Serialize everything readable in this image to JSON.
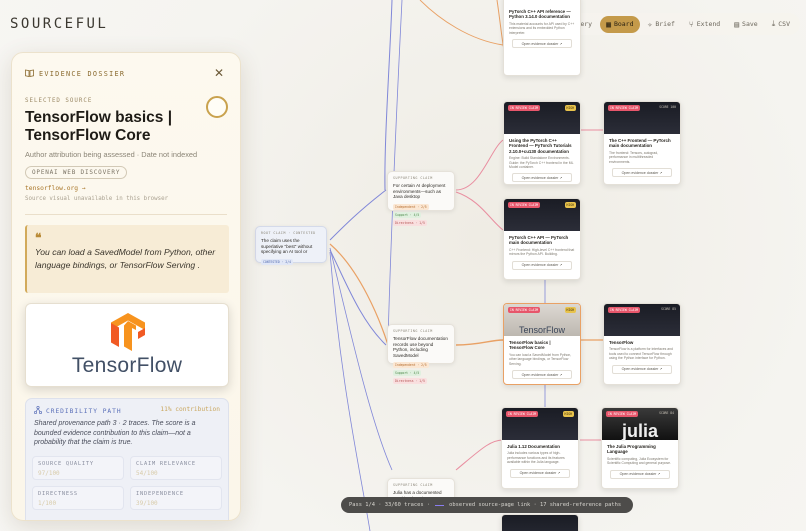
{
  "app": {
    "brand": "SOURCEFUL"
  },
  "toolbar": {
    "items": [
      {
        "label": "Discovery",
        "icon": "compass-icon"
      },
      {
        "label": "Board",
        "icon": "board-icon",
        "active": true
      },
      {
        "label": "Brief",
        "icon": "sparkle-icon"
      },
      {
        "label": "Extend",
        "icon": "branch-icon"
      },
      {
        "label": "Save",
        "icon": "save-icon"
      },
      {
        "label": "CSV",
        "icon": "download-icon"
      }
    ]
  },
  "dossier": {
    "header": "EVIDENCE DOSSIER",
    "selected_label": "SELECTED SOURCE",
    "title": "TensorFlow basics | TensorFlow Core",
    "meta": "Author attribution being assessed · Date not indexed",
    "chip": "OPENAI WEB DISCOVERY",
    "link": "tensorflow.org →",
    "note": "Source visual unavailable in this browser",
    "quote": "You can load a SavedModel from Python, other language bindings, or TensorFlow Serving .",
    "image_word": "TensorFlow",
    "credibility": {
      "heading": "CREDIBILITY PATH",
      "contribution": "11% contribution",
      "text": "Shared provenance path 3 · 2 traces. The score is a bounded evidence contribution to this claim—not a probability that the claim is true.",
      "metrics": [
        {
          "label": "SOURCE QUALITY",
          "value": "97/100"
        },
        {
          "label": "CLAIM RELEVANCE",
          "value": "54/100"
        },
        {
          "label": "DIRECTNESS",
          "value": "1/100"
        },
        {
          "label": "INDEPENDENCE",
          "value": "39/100"
        }
      ]
    }
  },
  "graph": {
    "root": {
      "tag": "ROOT CLAIM · CONTESTED",
      "text": "The claim uses the superlative \"best\" without specifying an AI tool or",
      "pill": "CONTESTED · 2/4"
    },
    "claims": [
      {
        "tag": "SUPPORTING CLAIM",
        "text": "For certain AI deployment environments—such as Java desktop",
        "pills": [
          "Independent · 2/5",
          "Support · 4/5",
          "Directness · 1/5"
        ]
      },
      {
        "tag": "SUPPORTING CLAIM",
        "text": "TensorFlow documentation records use beyond Python, including SavedModel",
        "pills": [
          "Independent · 2/5",
          "Support · 4/5",
          "Directness · 1/5"
        ]
      },
      {
        "tag": "SUPPORTING CLAIM",
        "text": "Julia has a documented machine-learning ecosystem and language-level"
      }
    ],
    "sources": [
      {
        "title": "PyTorch C++ API reference — Python 3.14.0 documentation",
        "desc": "This material accounts for API used by C++ extensions and its embedded Python interpreter.",
        "button": "Open evidence dossier ↗",
        "badge": "",
        "score": ""
      },
      {
        "title": "Using the PyTorch C++ Frontend — PyTorch Tutorials 2.10.0+cu130 documentation",
        "desc": "Engine: Build Standalone Environments. Guide: the PyTorch C++ frontend in the ML Model container.",
        "button": "Open evidence dossier ↗",
        "badge": "IN REVIEW CLAIM",
        "score": "HIGH"
      },
      {
        "title": "The C++ Frontend — PyTorch main documentation",
        "desc": "The frontend: Tensors, autograd, performance in multithreaded environments.",
        "button": "Open evidence dossier ↗",
        "badge": "IN REVIEW CLAIM",
        "score": "SCORE 100"
      },
      {
        "title": "PyTorch C++ API — PyTorch main documentation",
        "desc": "C++ Frontend: High-level C++ frontend that mirrors the Python API. Building.",
        "button": "Open evidence dossier ↗",
        "badge": "IN REVIEW CLAIM",
        "score": "HIGH"
      },
      {
        "title": "TensorFlow basics | TensorFlow Core",
        "desc": "You can load a SavedModel from Python, other language bindings, or TensorFlow Serving.",
        "button": "Open evidence dossier ↗",
        "badge": "IN REVIEW CLAIM",
        "score": "HIGH",
        "image_word": "TensorFlow"
      },
      {
        "title": "TensorFlow",
        "desc": "TensorFlow is a platform for interfaces and tools used to connect TensorFlow through using the Python interface for Python.",
        "button": "Open evidence dossier ↗",
        "badge": "IN REVIEW CLAIM",
        "score": "SCORE 85"
      },
      {
        "title": "Julia 1.12 Documentation",
        "desc": "Julia includes various types of high-performance functions and its features available within the Julia language.",
        "button": "Open evidence dossier ↗",
        "badge": "IN REVIEW CLAIM",
        "score": "HIGH"
      },
      {
        "title": "The Julia Programming Language",
        "desc": "Scientific computing, Julia Ecosystem for Scientific Computing and general purpose.",
        "button": "Open evidence dossier ↗",
        "badge": "IN REVIEW CLAIM",
        "score": "SCORE 84",
        "image_word": "julia"
      }
    ]
  },
  "status_bar": {
    "pass": "Pass 1/4 · 33/60 traces ·",
    "legend": "observed source-page link · 17 shared-reference paths"
  },
  "colors": {
    "accent": "#c49a4a",
    "edge_blue": "#7b82d6",
    "edge_orange": "#e9a165",
    "edge_pink": "#e98ea0",
    "panel_bg": "#fdf9ef"
  }
}
